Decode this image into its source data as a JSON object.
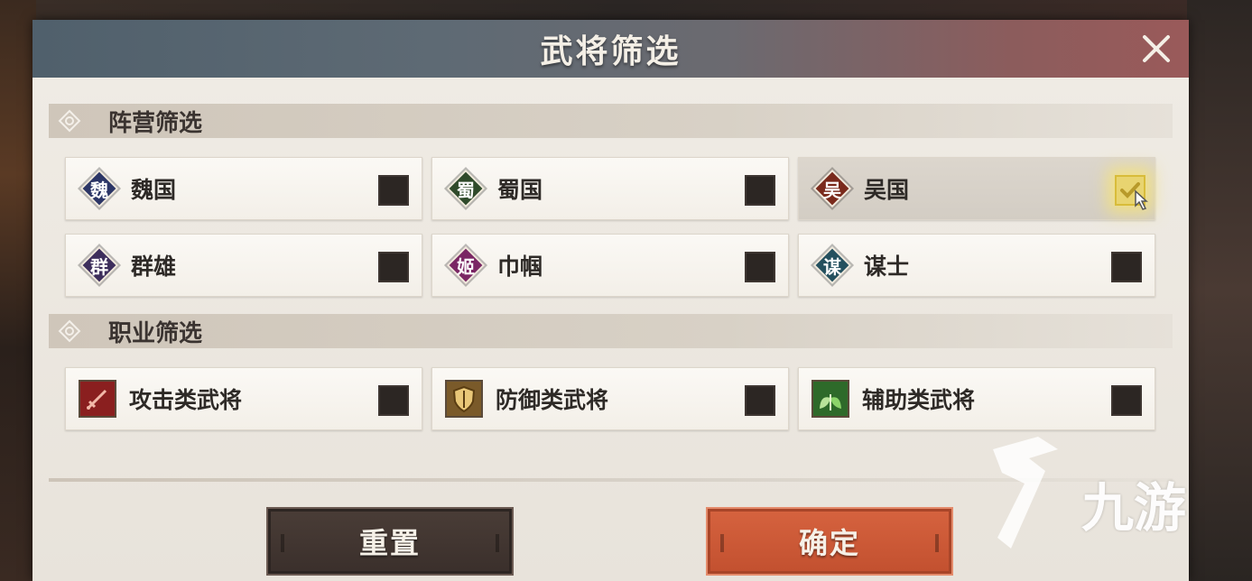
{
  "dialog": {
    "title": "武将筛选",
    "close_icon": "close-icon"
  },
  "faction_section": {
    "title": "阵营筛选",
    "icon": "diamond-eye-icon",
    "options": [
      {
        "glyph": "魏",
        "label": "魏国",
        "color": "#2b3566",
        "checked": false
      },
      {
        "glyph": "蜀",
        "label": "蜀国",
        "color": "#2f4a2a",
        "checked": false
      },
      {
        "glyph": "吴",
        "label": "吴国",
        "color": "#7a2a1c",
        "checked": true
      },
      {
        "glyph": "群",
        "label": "群雄",
        "color": "#3d2e5c",
        "checked": false
      },
      {
        "glyph": "姬",
        "label": "巾帼",
        "color": "#7a2664",
        "checked": false
      },
      {
        "glyph": "谋",
        "label": "谋士",
        "color": "#24505e",
        "checked": false
      }
    ]
  },
  "role_section": {
    "title": "职业筛选",
    "icon": "diamond-eye-icon",
    "options": [
      {
        "label": "攻击类武将",
        "icon": "sword-icon",
        "color": "#8a1f1f",
        "checked": false
      },
      {
        "label": "防御类武将",
        "icon": "shield-icon",
        "color": "#7a5a2a",
        "checked": false
      },
      {
        "label": "辅助类武将",
        "icon": "leaf-icon",
        "color": "#2e6a2a",
        "checked": false
      }
    ]
  },
  "buttons": {
    "reset": "重置",
    "confirm": "确定"
  },
  "watermark": {
    "text": "九游",
    "icon": "nine-game-logo-icon"
  }
}
